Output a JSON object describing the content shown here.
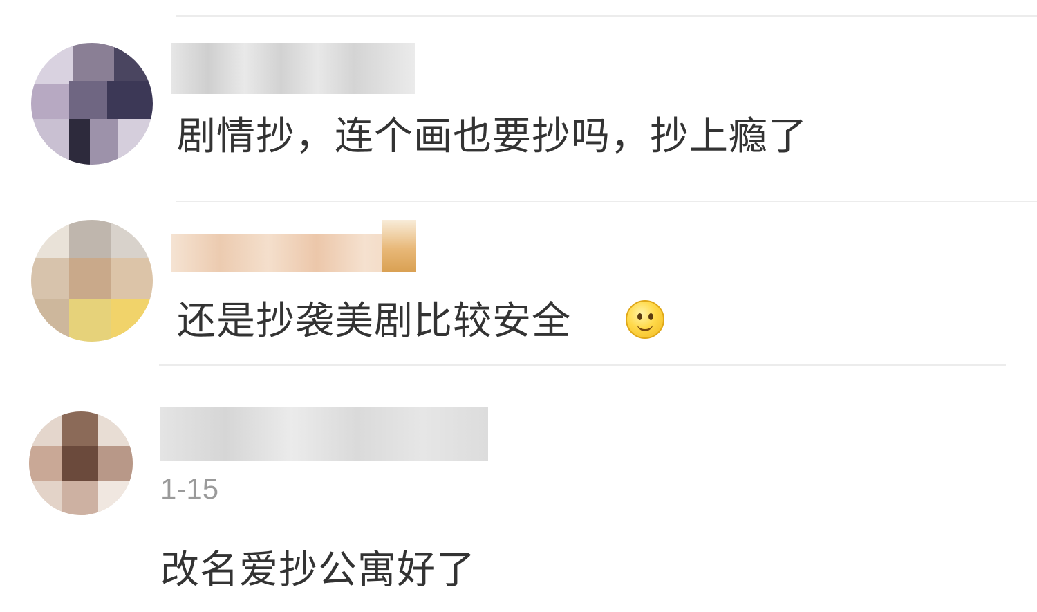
{
  "comments": [
    {
      "text": "剧情抄，连个画也要抄吗，抄上瘾了",
      "date": ""
    },
    {
      "text": "还是抄袭美剧比较安全",
      "emoji": "smile-emoji",
      "date": ""
    },
    {
      "text": "改名爱抄公寓好了",
      "date": "1-15"
    }
  ],
  "colors": {
    "comment_text": "#333333",
    "date_text": "#9a9a9a",
    "divider": "#ececec",
    "background": "#ffffff"
  }
}
